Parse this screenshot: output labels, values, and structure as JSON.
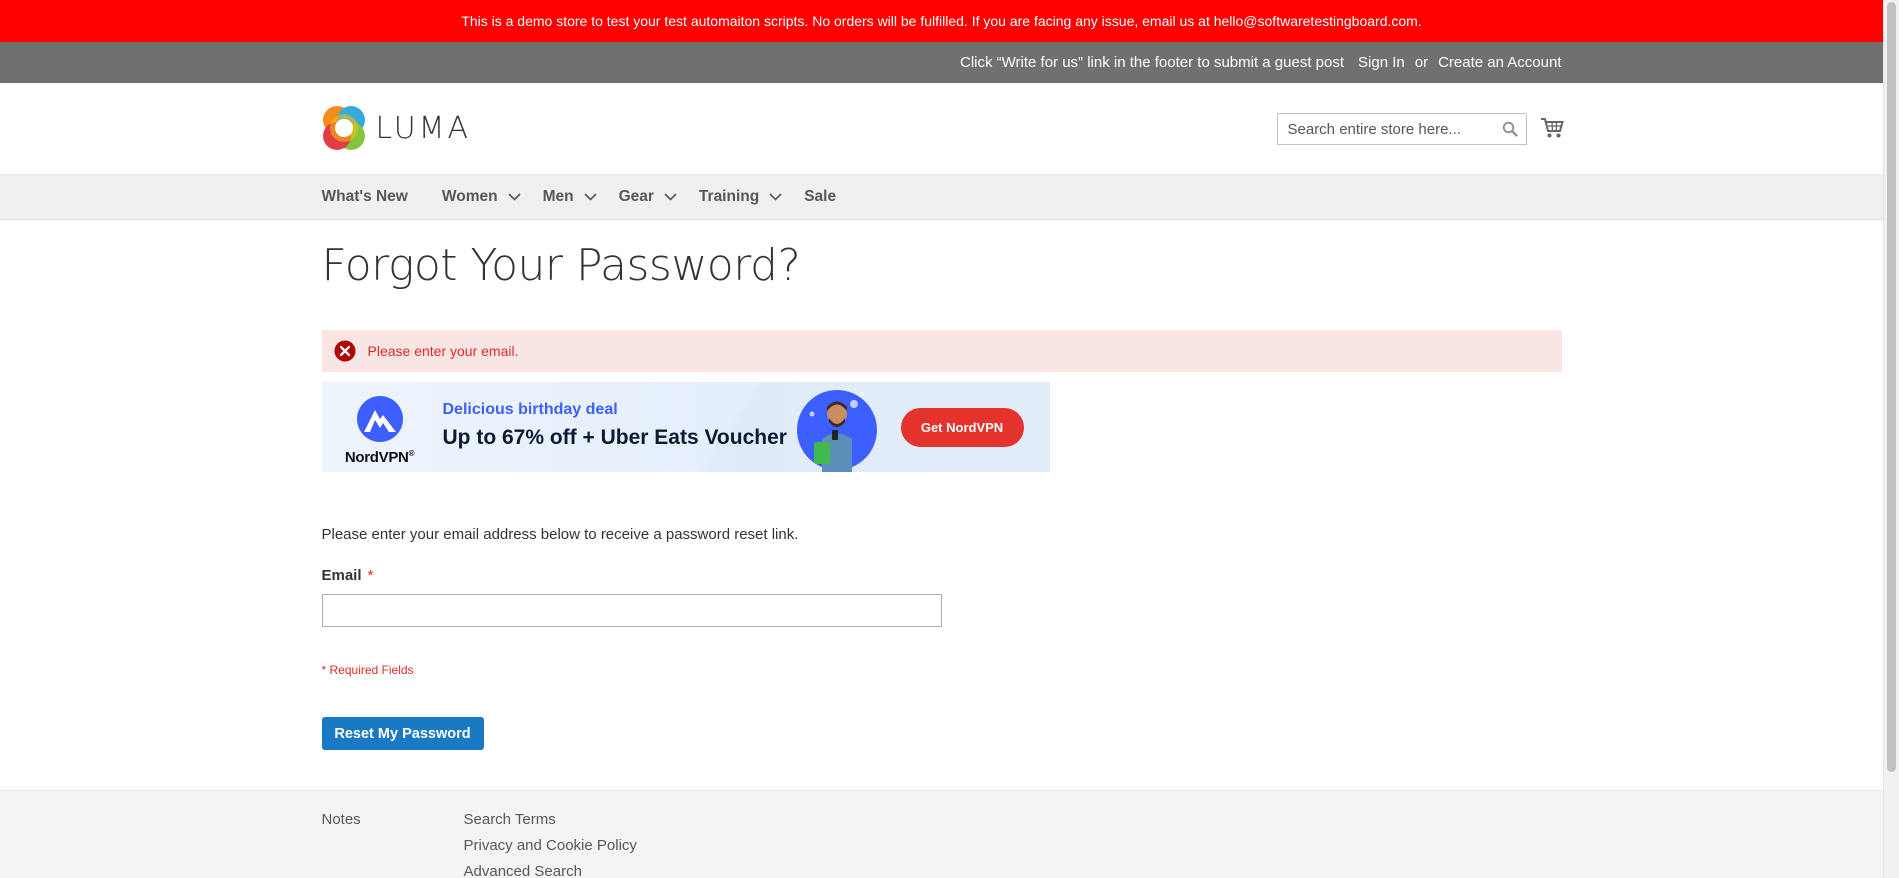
{
  "demo_notice": "This is a demo store to test your test automaiton scripts. No orders will be fulfilled. If you are facing any issue, email us at hello@softwaretestingboard.com.",
  "panel": {
    "guest_post": "Click “Write for us” link in the footer to submit a guest post",
    "sign_in": "Sign In",
    "or": "or",
    "create_account": "Create an Account"
  },
  "header": {
    "logo_text": "LUMA",
    "search_placeholder": "Search entire store here...",
    "search_value": "",
    "icons": {
      "search": "search-icon",
      "cart": "cart-icon"
    }
  },
  "nav": {
    "items": [
      {
        "label": "What's New",
        "has_submenu": false
      },
      {
        "label": "Women",
        "has_submenu": true
      },
      {
        "label": "Men",
        "has_submenu": true
      },
      {
        "label": "Gear",
        "has_submenu": true
      },
      {
        "label": "Training",
        "has_submenu": true
      },
      {
        "label": "Sale",
        "has_submenu": false
      }
    ]
  },
  "page": {
    "title": "Forgot Your Password?",
    "error_message": "Please enter your email.",
    "intro": "Please enter your email address below to receive a password reset link.",
    "email_label": "Email",
    "required_mark": "*",
    "email_value": "",
    "required_note": "* Required Fields",
    "submit_label": "Reset My Password"
  },
  "ad": {
    "brand": "NordVPN",
    "brand_mark": "®",
    "deal": "Delicious birthday deal",
    "offer": "Up to 67% off + Uber Eats Voucher",
    "cta": "Get NordVPN"
  },
  "footer": {
    "col1": [
      "Notes"
    ],
    "col2": [
      "Search Terms",
      "Privacy and Cookie Policy",
      "Advanced Search"
    ]
  },
  "colors": {
    "demo_bar": "#ff0000",
    "panel_header": "#6e716e",
    "error_bg": "#fae5e5",
    "error_text": "#e02b27",
    "primary_button": "#1979c3",
    "ad_cta": "#e5322d"
  }
}
